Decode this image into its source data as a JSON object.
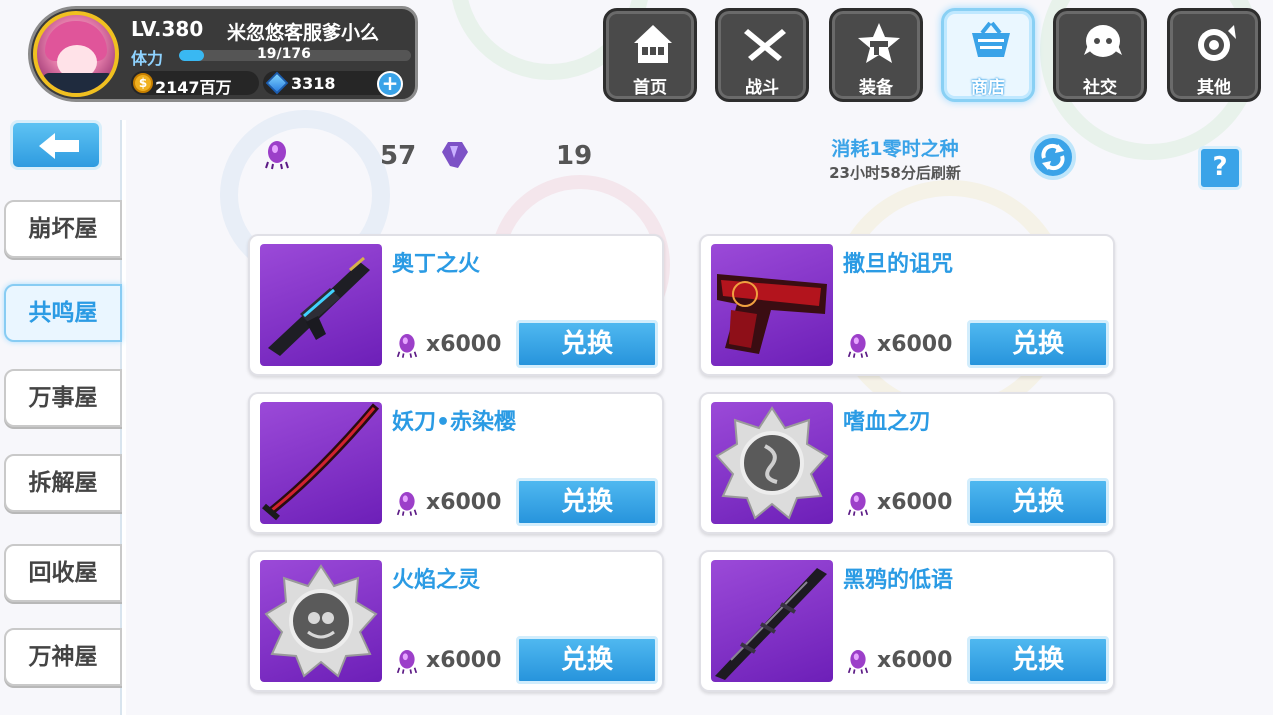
{
  "player": {
    "level": "LV.380",
    "name": "米忽悠客服爹小么",
    "stamina_label": "体力",
    "stamina_value": "19/176",
    "stamina_ratio": 0.108,
    "gold": "2147百万",
    "crystals": "3318",
    "add_symbol": "+"
  },
  "nav": [
    {
      "label": "首页",
      "icon": "home-icon",
      "active": false
    },
    {
      "label": "战斗",
      "icon": "crossed-swords-icon",
      "active": false
    },
    {
      "label": "装备",
      "icon": "gun-star-icon",
      "active": false
    },
    {
      "label": "商店",
      "icon": "shop-basket-icon",
      "active": true
    },
    {
      "label": "社交",
      "icon": "ghost-face-icon",
      "active": false
    },
    {
      "label": "其他",
      "icon": "target-snail-icon",
      "active": false
    }
  ],
  "sidebar": {
    "items": [
      {
        "label": "崩坏屋",
        "active": false
      },
      {
        "label": "共鸣屋",
        "active": true
      },
      {
        "label": "万事屋",
        "active": false
      },
      {
        "label": "拆解屋",
        "active": false
      },
      {
        "label": "回收屋",
        "active": false
      },
      {
        "label": "万神屋",
        "active": false
      }
    ]
  },
  "currencies": {
    "seed_count": "57",
    "shard_count": "19"
  },
  "refresh": {
    "cost_text": "消耗1零时之种",
    "timer_text": "23小时58分后刷新"
  },
  "help_label": "?",
  "items": [
    {
      "name": "奥丁之火",
      "price": "x6000",
      "button": "兑换",
      "image": "rifle"
    },
    {
      "name": "撒旦的诅咒",
      "price": "x6000",
      "button": "兑换",
      "image": "red-pistol"
    },
    {
      "name": "妖刀•赤染樱",
      "price": "x6000",
      "button": "兑换",
      "image": "katana"
    },
    {
      "name": "嗜血之刃",
      "price": "x6000",
      "button": "兑换",
      "image": "medal"
    },
    {
      "name": "火焰之灵",
      "price": "x6000",
      "button": "兑换",
      "image": "medal"
    },
    {
      "name": "黑鸦的低语",
      "price": "x6000",
      "button": "兑换",
      "image": "dark-blade"
    }
  ],
  "colors": {
    "accent": "#2b9be4",
    "item_bg": "#7b2cc6",
    "panel_dark": "#3a3a3a"
  }
}
